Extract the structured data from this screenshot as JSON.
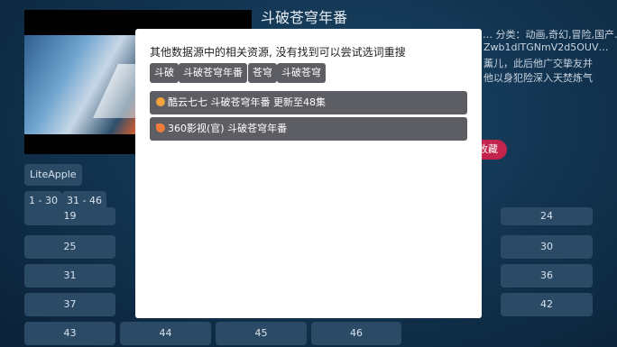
{
  "video": {
    "title": "斗破苍穹年番",
    "meta_top": "… 分类：动画,奇幻,冒险,国产…",
    "meta_id": "Zwb1dlTGNmV2d5OUV…",
    "desc_1": "薰儿，此后他广交挚友并",
    "desc_2": "他以身犯险深入天焚炼气",
    "favorite_label": "收藏"
  },
  "source_label": "LiteApple",
  "ranges": [
    "1 - 30",
    "31 - 46"
  ],
  "episodes": {
    "row0": [
      "19",
      "24"
    ],
    "row1": [
      "25",
      "30"
    ],
    "row2": [
      "31",
      "36"
    ],
    "row3": [
      "37",
      "42"
    ],
    "row4": [
      "43",
      "44",
      "45",
      "46"
    ]
  },
  "modal": {
    "message": "其他数据源中的相关资源, 没有找到可以尝试选词重搜",
    "keywords": [
      "斗破",
      "斗破苍穹年番",
      "苍穹",
      "斗破苍穹"
    ],
    "results": [
      {
        "icon": "cloud-source-icon",
        "text": "酷云七七  斗破苍穹年番  更新至48集",
        "color": "#f2a23a"
      },
      {
        "icon": "heart-source-icon",
        "text": "360影视(官)  斗破苍穹年番",
        "color": "#f07b3a"
      }
    ]
  }
}
